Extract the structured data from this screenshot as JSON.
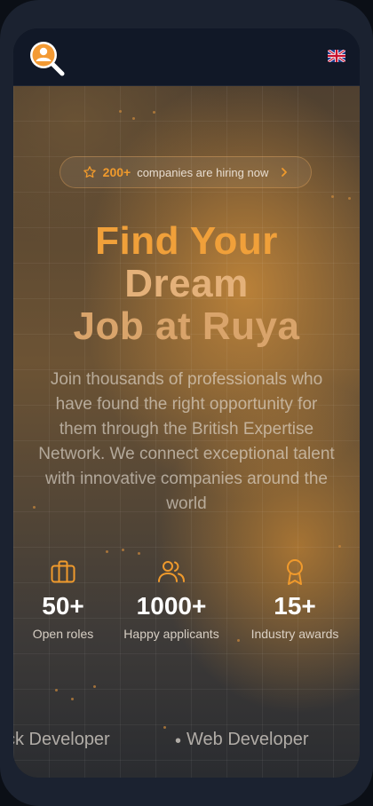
{
  "header": {
    "logo_icon": "search-person-icon",
    "language_flag": "uk-flag-icon"
  },
  "hero": {
    "badge": {
      "icon": "star-icon",
      "count": "200+",
      "text": "companies are hiring now",
      "chevron": "›"
    },
    "title": {
      "line1": "Find Your",
      "line2": "Dream",
      "line3": "Job at Ruya"
    },
    "description": "Join thousands of professionals who have found the right opportunity for them through the British Expertise Network. We connect exceptional talent with innovative companies around the world",
    "stats": [
      {
        "icon": "briefcase-icon",
        "value": "50+",
        "label": "Open roles"
      },
      {
        "icon": "users-icon",
        "value": "1000+",
        "label": "Happy applicants"
      },
      {
        "icon": "award-icon",
        "value": "15+",
        "label": "Industry awards"
      }
    ],
    "ticker": [
      "ck Developer",
      "•",
      "Web Developer"
    ]
  },
  "colors": {
    "accent": "#f09a2c",
    "title_gold": "#e4b17a",
    "topbar_bg": "#111827",
    "frame": "#1b2230"
  }
}
